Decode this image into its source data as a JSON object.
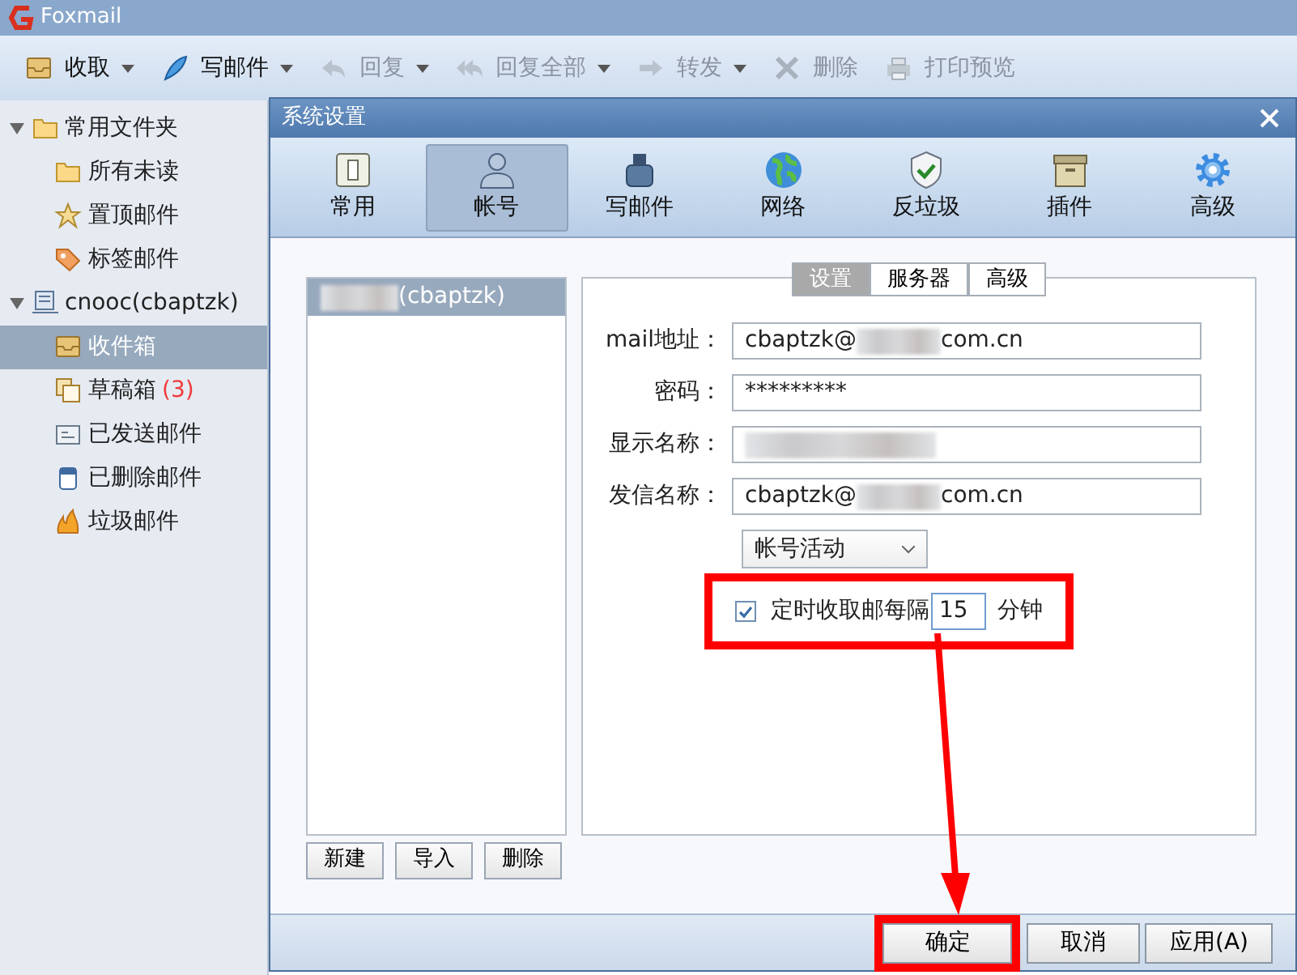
{
  "app": {
    "title": "Foxmail"
  },
  "toolbar": [
    {
      "label": "收取",
      "kind": "inbox",
      "dropdown": true,
      "disabled": false
    },
    {
      "label": "写邮件",
      "kind": "feather",
      "dropdown": true,
      "disabled": false
    },
    {
      "label": "回复",
      "kind": "reply",
      "dropdown": true,
      "disabled": true
    },
    {
      "label": "回复全部",
      "kind": "replyall",
      "dropdown": true,
      "disabled": true
    },
    {
      "label": "转发",
      "kind": "forward",
      "dropdown": true,
      "disabled": true
    },
    {
      "label": "删除",
      "kind": "delete",
      "dropdown": false,
      "disabled": true
    },
    {
      "label": "打印预览",
      "kind": "printer",
      "dropdown": false,
      "disabled": true
    }
  ],
  "sidebar": [
    {
      "label": "常用文件夹",
      "kind": "folder",
      "expanded": true,
      "selected": false,
      "children": [
        {
          "label": "所有未读",
          "kind": "folder",
          "selected": false
        },
        {
          "label": "置顶邮件",
          "kind": "star",
          "selected": false
        },
        {
          "label": "标签邮件",
          "kind": "tag",
          "selected": false
        }
      ]
    },
    {
      "label": "cnooc(cbaptzk)",
      "kind": "account",
      "expanded": true,
      "selected": false,
      "children": [
        {
          "label": "收件箱",
          "kind": "inbox",
          "selected": true
        },
        {
          "label": "草稿箱",
          "count": "(3)",
          "kind": "drafts",
          "selected": false
        },
        {
          "label": "已发送邮件",
          "kind": "sent",
          "selected": false
        },
        {
          "label": "已删除邮件",
          "kind": "trash",
          "selected": false
        },
        {
          "label": "垃圾邮件",
          "kind": "junk",
          "selected": false
        }
      ]
    }
  ],
  "dialog": {
    "title": "系统设置",
    "categories": [
      {
        "label": "常用",
        "kind": "general",
        "selected": false
      },
      {
        "label": "帐号",
        "kind": "person",
        "selected": true
      },
      {
        "label": "写邮件",
        "kind": "ink",
        "selected": false
      },
      {
        "label": "网络",
        "kind": "globe",
        "selected": false
      },
      {
        "label": "反垃圾",
        "kind": "shield",
        "selected": false
      },
      {
        "label": "插件",
        "kind": "box",
        "selected": false
      },
      {
        "label": "高级",
        "kind": "gear",
        "selected": false
      }
    ],
    "accounts": [
      {
        "label": "(cbaptzk)",
        "redacted": true,
        "selected": true
      }
    ],
    "account_buttons": [
      "新建",
      "导入",
      "删除"
    ],
    "tabs": [
      {
        "label": "设置",
        "selected": true
      },
      {
        "label": "服务器",
        "selected": false
      },
      {
        "label": "高级",
        "selected": false
      }
    ],
    "fields": [
      {
        "label": "mail地址：",
        "kind": "redacted",
        "before": "cbaptzk@",
        "after": "com.cn"
      },
      {
        "label": "密码：",
        "kind": "text",
        "value": "*********"
      },
      {
        "label": "显示名称：",
        "kind": "redacted"
      },
      {
        "label": "发信名称：",
        "kind": "redacted",
        "before": "cbaptzk@",
        "after": "com.cn"
      }
    ],
    "status_select": {
      "value": "帐号活动"
    },
    "auto_receive": {
      "checked": true,
      "label": "定时收取邮",
      "label_2": "每隔",
      "interval": "15",
      "unit": "分钟",
      "highlighted": true
    },
    "buttons": [
      {
        "label": "确定",
        "highlighted": true
      },
      {
        "label": "取消",
        "highlighted": false
      },
      {
        "label": "应用(A)",
        "highlighted": false
      }
    ],
    "annotation_arrow": true
  }
}
